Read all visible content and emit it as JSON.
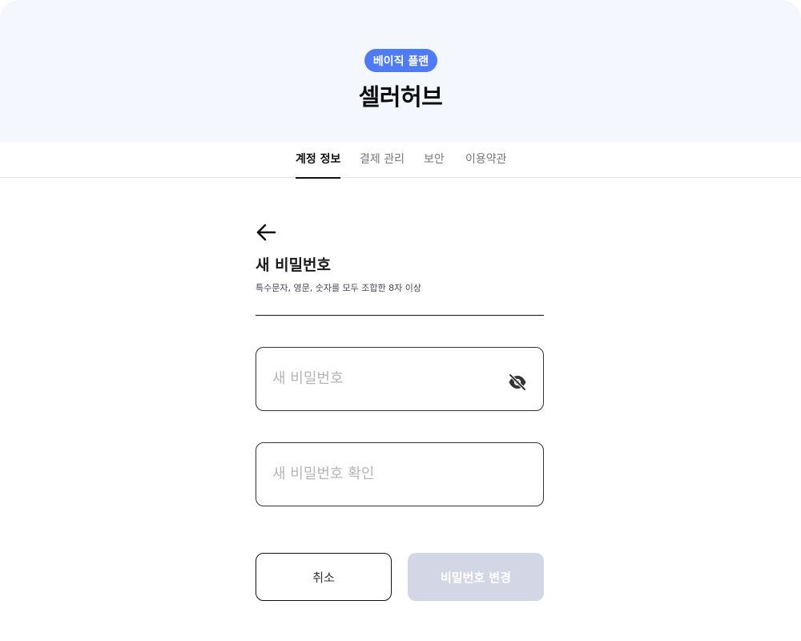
{
  "header": {
    "plan_badge": "베이직 플랜",
    "brand": "셀러허브"
  },
  "tabs": [
    {
      "label": "계정 정보",
      "active": true
    },
    {
      "label": "결제 관리",
      "active": false
    },
    {
      "label": "보안",
      "active": false
    },
    {
      "label": "이용약관",
      "active": false
    }
  ],
  "form": {
    "back_icon": "arrow-left-icon",
    "title": "새 비밀번호",
    "subtitle": "특수문자, 영문, 숫자를 모두 조합한 8자 이상",
    "new_password": {
      "value": "",
      "placeholder": "새 비밀번호",
      "toggle_icon": "eye-off-icon"
    },
    "confirm_password": {
      "value": "",
      "placeholder": "새 비밀번호 확인"
    },
    "cancel_label": "취소",
    "submit_label": "비밀번호 변경"
  },
  "colors": {
    "accent": "#4f7cf6",
    "hero_bg": "#f5f7ff",
    "submit_disabled": "#d3d6e4"
  }
}
